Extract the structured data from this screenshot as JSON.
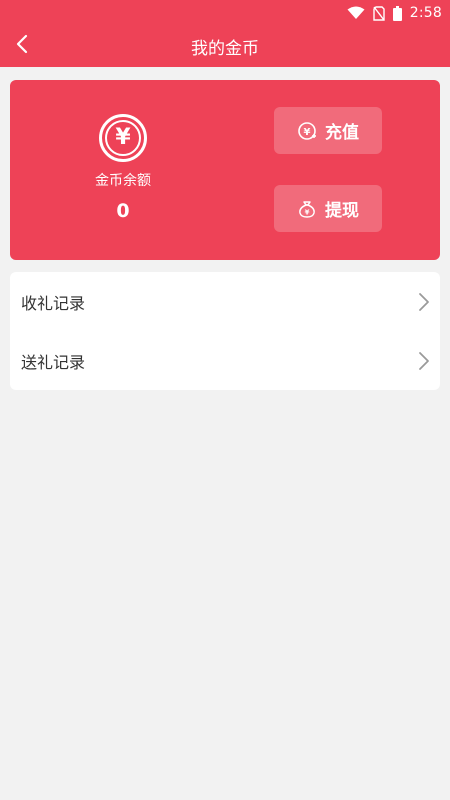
{
  "status_bar": {
    "time": "2:58",
    "icons": [
      "wifi-icon",
      "no-sim-icon",
      "battery-icon"
    ]
  },
  "header": {
    "title": "我的金币",
    "back_icon": "chevron-left-icon"
  },
  "balance_card": {
    "coin_symbol": "¥",
    "label": "金币余额",
    "value": "0",
    "recharge_label": "充值",
    "withdraw_label": "提现"
  },
  "records": {
    "items": [
      {
        "label": "收礼记录",
        "icon": "chevron-right-icon"
      },
      {
        "label": "送礼记录",
        "icon": "chevron-right-icon"
      }
    ]
  },
  "colors": {
    "accent": "#ee4257",
    "background": "#f2f2f2",
    "card": "#ffffff",
    "text": "#333333"
  }
}
